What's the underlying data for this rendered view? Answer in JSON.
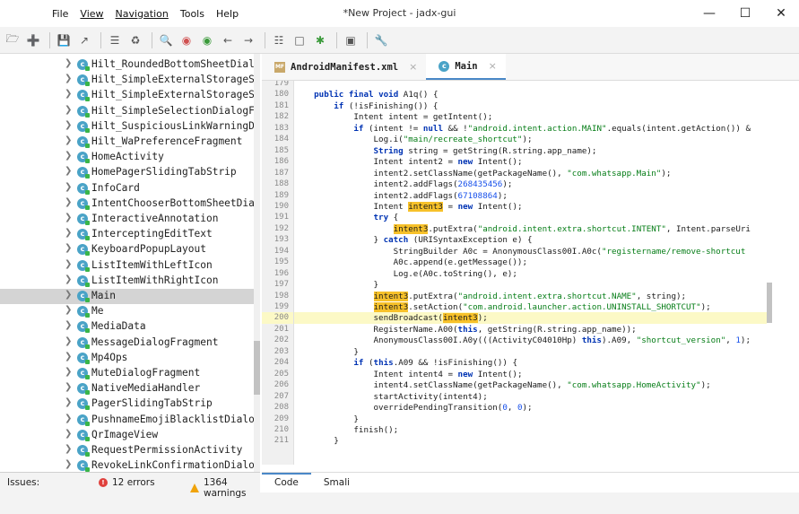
{
  "window": {
    "title": "*New Project - jadx-gui",
    "menu": [
      "File",
      "View",
      "Navigation",
      "Tools",
      "Help"
    ],
    "controls": [
      "minimize",
      "maximize",
      "close"
    ]
  },
  "toolbar": {
    "icons": [
      "open-folder-icon",
      "add-files-icon",
      "save-icon",
      "export-icon",
      "flatten-icon",
      "sync-icon",
      "search-icon",
      "find-class-icon",
      "find-usage-icon",
      "back-icon",
      "forward-icon",
      "log-icon",
      "deobfuscate-icon",
      "debug-icon",
      "preferences-icon",
      "settings-icon"
    ]
  },
  "tree": {
    "items": [
      "Hilt_RoundedBottomSheetDialc",
      "Hilt_SimpleExternalStorageSt",
      "Hilt_SimpleExternalStorageSt",
      "Hilt_SimpleSelectionDialogFr",
      "Hilt_SuspiciousLinkWarningDi",
      "Hilt_WaPreferenceFragment",
      "HomeActivity",
      "HomePagerSlidingTabStrip",
      "InfoCard",
      "IntentChooserBottomSheetDial",
      "InteractiveAnnotation",
      "InterceptingEditText",
      "KeyboardPopupLayout",
      "ListItemWithLeftIcon",
      "ListItemWithRightIcon",
      "Main",
      "Me",
      "MediaData",
      "MessageDialogFragment",
      "Mp4Ops",
      "MuteDialogFragment",
      "NativeMediaHandler",
      "PagerSlidingTabStrip",
      "PushnameEmojiBlacklistDialog",
      "QrImageView",
      "RequestPermissionActivity",
      "RevokeLinkConfirmationDialog"
    ],
    "selected_index": 15
  },
  "tabs": [
    {
      "label": "AndroidManifest.xml",
      "icon": "xml-file-icon",
      "active": false
    },
    {
      "label": "Main",
      "icon": "class-icon",
      "active": true
    }
  ],
  "code": {
    "current_line": 200,
    "lines": [
      {
        "n": "179",
        "t": ""
      },
      {
        "n": "180",
        "t": "    public final void A1q() {"
      },
      {
        "n": "181",
        "t": "        if (!isFinishing()) {"
      },
      {
        "n": "182",
        "t": "            Intent intent = getIntent();"
      },
      {
        "n": "183",
        "t": "            if (intent != null && !\"android.intent.action.MAIN\".equals(intent.getAction()) &"
      },
      {
        "n": "184",
        "t": "                Log.i(\"main/recreate_shortcut\");"
      },
      {
        "n": "185",
        "t": "                String string = getString(R.string.app_name);"
      },
      {
        "n": "186",
        "t": "                Intent intent2 = new Intent();"
      },
      {
        "n": "187",
        "t": "                intent2.setClassName(getPackageName(), \"com.whatsapp.Main\");"
      },
      {
        "n": "188",
        "t": "                intent2.addFlags(268435456);"
      },
      {
        "n": "189",
        "t": "                intent2.addFlags(67108864);"
      },
      {
        "n": "190",
        "t": "                Intent intent3 = new Intent();"
      },
      {
        "n": "191",
        "t": "                try {"
      },
      {
        "n": "192",
        "t": "                    intent3.putExtra(\"android.intent.extra.shortcut.INTENT\", Intent.parseUri"
      },
      {
        "n": "193",
        "t": "                } catch (URISyntaxException e) {"
      },
      {
        "n": "194",
        "t": "                    StringBuilder A0c = AnonymousClass00I.A0c(\"registername/remove-shortcut"
      },
      {
        "n": "195",
        "t": "                    A0c.append(e.getMessage());"
      },
      {
        "n": "196",
        "t": "                    Log.e(A0c.toString(), e);"
      },
      {
        "n": "197",
        "t": "                }"
      },
      {
        "n": "198",
        "t": "                intent3.putExtra(\"android.intent.extra.shortcut.NAME\", string);"
      },
      {
        "n": "199",
        "t": "                intent3.setAction(\"com.android.launcher.action.UNINSTALL_SHORTCUT\");"
      },
      {
        "n": "200",
        "t": "                sendBroadcast(intent3);"
      },
      {
        "n": "201",
        "t": "                RegisterName.A00(this, getString(R.string.app_name));"
      },
      {
        "n": "202",
        "t": "                AnonymousClass00I.A0y(((ActivityC04010Hp) this).A09, \"shortcut_version\", 1);"
      },
      {
        "n": "203",
        "t": "            }"
      },
      {
        "n": "204",
        "t": "            if (this.A09 && !isFinishing()) {"
      },
      {
        "n": "205",
        "t": "                Intent intent4 = new Intent();"
      },
      {
        "n": "206",
        "t": "                intent4.setClassName(getPackageName(), \"com.whatsapp.HomeActivity\");"
      },
      {
        "n": "207",
        "t": "                startActivity(intent4);"
      },
      {
        "n": "208",
        "t": "                overridePendingTransition(0, 0);"
      },
      {
        "n": "209",
        "t": "            }"
      },
      {
        "n": "210",
        "t": "            finish();"
      },
      {
        "n": "211",
        "t": "        }"
      }
    ]
  },
  "bottom_tabs": [
    {
      "label": "Code",
      "active": true
    },
    {
      "label": "Smali",
      "active": false
    }
  ],
  "status": {
    "issues_label": "Issues:",
    "errors": "12 errors",
    "warnings": "1364 warnings"
  },
  "colors": {
    "keyword": "#0033b3",
    "string": "#067d17",
    "number": "#1750eb",
    "highlight": "#f7c12a",
    "current_line": "#fcf9c6",
    "selected_row": "#d4d4d4"
  }
}
